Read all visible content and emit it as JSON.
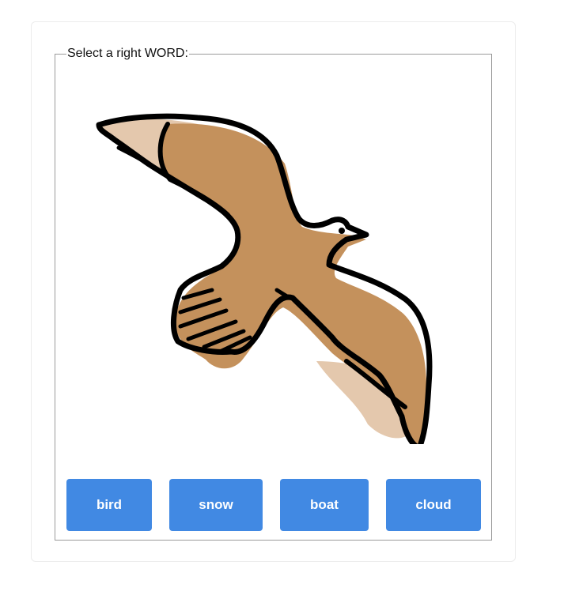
{
  "quiz": {
    "legend": "Select a right WORD:",
    "picture_icon": "bird-icon",
    "options": [
      "bird",
      "snow",
      "boat",
      "cloud"
    ]
  },
  "colors": {
    "button_bg": "#4189e3",
    "button_text": "#ffffff",
    "bird_body": "#c4915c",
    "bird_wing_light": "#e4c8ad",
    "outline": "#000000"
  }
}
